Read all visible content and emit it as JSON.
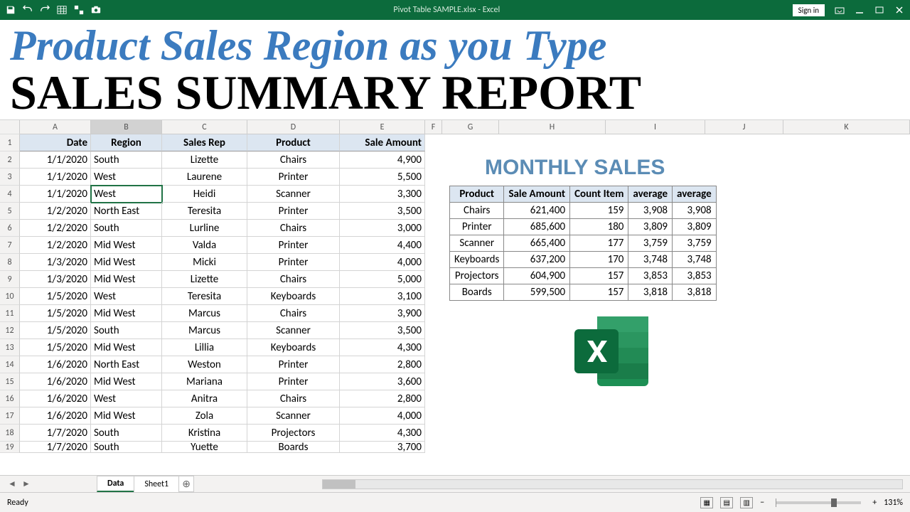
{
  "titlebar": {
    "filename": "Pivot Table SAMPLE.xlsx - Excel",
    "signin": "Sign in"
  },
  "overlay": {
    "line1": "Product Sales Region as you Type",
    "line2": "SALES SUMMARY REPORT"
  },
  "columns": [
    "A",
    "B",
    "C",
    "D",
    "E",
    "F",
    "G",
    "H",
    "I",
    "J",
    "K"
  ],
  "headers": {
    "date": "Date",
    "region": "Region",
    "rep": "Sales Rep",
    "product": "Product",
    "amount": "Sale Amount"
  },
  "rows": [
    {
      "n": 2,
      "date": "1/1/2020",
      "region": "South",
      "rep": "Lizette",
      "product": "Chairs",
      "amount": "4,900"
    },
    {
      "n": 3,
      "date": "1/1/2020",
      "region": "West",
      "rep": "Laurene",
      "product": "Printer",
      "amount": "5,500"
    },
    {
      "n": 4,
      "date": "1/1/2020",
      "region": "West",
      "rep": "Heidi",
      "product": "Scanner",
      "amount": "3,300",
      "selected": true
    },
    {
      "n": 5,
      "date": "1/2/2020",
      "region": "North East",
      "rep": "Teresita",
      "product": "Printer",
      "amount": "3,500"
    },
    {
      "n": 6,
      "date": "1/2/2020",
      "region": "South",
      "rep": "Lurline",
      "product": "Chairs",
      "amount": "3,000"
    },
    {
      "n": 7,
      "date": "1/2/2020",
      "region": "Mid West",
      "rep": "Valda",
      "product": "Printer",
      "amount": "4,400"
    },
    {
      "n": 8,
      "date": "1/3/2020",
      "region": "Mid West",
      "rep": "Micki",
      "product": "Printer",
      "amount": "4,000"
    },
    {
      "n": 9,
      "date": "1/3/2020",
      "region": "Mid West",
      "rep": "Lizette",
      "product": "Chairs",
      "amount": "5,000"
    },
    {
      "n": 10,
      "date": "1/5/2020",
      "region": "West",
      "rep": "Teresita",
      "product": "Keyboards",
      "amount": "3,100"
    },
    {
      "n": 11,
      "date": "1/5/2020",
      "region": "Mid West",
      "rep": "Marcus",
      "product": "Chairs",
      "amount": "3,900"
    },
    {
      "n": 12,
      "date": "1/5/2020",
      "region": "South",
      "rep": "Marcus",
      "product": "Scanner",
      "amount": "3,500"
    },
    {
      "n": 13,
      "date": "1/5/2020",
      "region": "Mid West",
      "rep": "Lillia",
      "product": "Keyboards",
      "amount": "4,300"
    },
    {
      "n": 14,
      "date": "1/6/2020",
      "region": "North East",
      "rep": "Weston",
      "product": "Printer",
      "amount": "2,800"
    },
    {
      "n": 15,
      "date": "1/6/2020",
      "region": "Mid West",
      "rep": "Mariana",
      "product": "Printer",
      "amount": "3,600"
    },
    {
      "n": 16,
      "date": "1/6/2020",
      "region": "West",
      "rep": "Anitra",
      "product": "Chairs",
      "amount": "2,800"
    },
    {
      "n": 17,
      "date": "1/6/2020",
      "region": "Mid West",
      "rep": "Zola",
      "product": "Scanner",
      "amount": "4,000"
    },
    {
      "n": 18,
      "date": "1/7/2020",
      "region": "South",
      "rep": "Kristina",
      "product": "Projectors",
      "amount": "4,300"
    },
    {
      "n": 19,
      "date": "1/7/2020",
      "region": "South",
      "rep": "Yuette",
      "product": "Boards",
      "amount": "3,700"
    }
  ],
  "summary": {
    "title": "MONTHLY SALES",
    "headers": [
      "Product",
      "Sale Amount",
      "Count Item",
      "average",
      "average"
    ],
    "rows": [
      [
        "Chairs",
        "621,400",
        "159",
        "3,908",
        "3,908"
      ],
      [
        "Printer",
        "685,600",
        "180",
        "3,809",
        "3,809"
      ],
      [
        "Scanner",
        "665,400",
        "177",
        "3,759",
        "3,759"
      ],
      [
        "Keyboards",
        "637,200",
        "170",
        "3,748",
        "3,748"
      ],
      [
        "Projectors",
        "604,900",
        "157",
        "3,853",
        "3,853"
      ],
      [
        "Boards",
        "599,500",
        "157",
        "3,818",
        "3,818"
      ]
    ]
  },
  "tabs": {
    "active": "Data",
    "other": "Sheet1"
  },
  "status": {
    "ready": "Ready",
    "zoom": "131%"
  }
}
